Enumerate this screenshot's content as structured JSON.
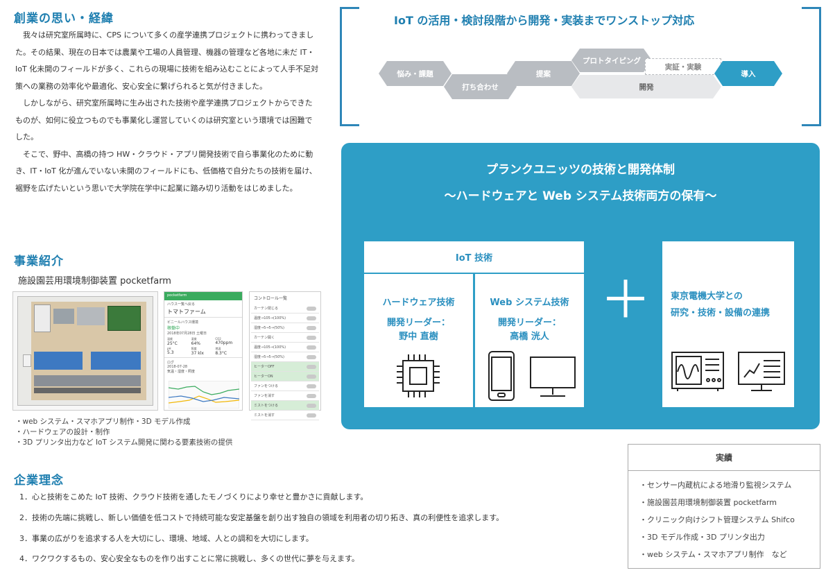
{
  "founding": {
    "heading": "創業の思い・経緯",
    "paragraphs": [
      "我々は研究室所属時に、CPS について多くの産学連携プロジェクトに携わってきました。その結果、現在の日本では農業や工場の人員管理、機器の管理など各地に未だ IT・IoT 化未開のフィールドが多く、これらの現場に技術を組み込むことによって人手不足対策への業務の効率化や最適化、安心安全に繋げられると気が付きました。",
      "しかしながら、研究室所属時に生み出された技術や産学連携プロジェクトからできたものが、如何に役立つものでも事業化し運営していくのは研究室という環境では困難でした。",
      "そこで、野中、高橋の持つ HW・クラウド・アプリ開発技術で自ら事業化のために動き、IT・IoT 化が進んでいない未開のフィールドにも、低価格で自分たちの技術を届け、裾野を広げたいという思いで大学院在学中に起業に踏み切り活動をはじめました。"
    ]
  },
  "business": {
    "heading": "事業紹介",
    "subheading": "施設園芸用環境制御装置 pocketfarm",
    "bullets": [
      "・web システム・スマホアプリ制作・3D モデル作成",
      "・ハードウェアの設計・制作",
      "・3D プリンタ出力など IoT システム開発に関わる要素技術の提供"
    ],
    "app1": {
      "header": "pocketfarm",
      "house_label": "ハウス一覧へ戻る",
      "house_name": "トマトファーム",
      "sensor_label": "ビニールハウス環境",
      "status": "稼働中",
      "date": "2018年07月28日 土曜日",
      "metrics": [
        {
          "label": "温度",
          "value": "25°C"
        },
        {
          "label": "湿度",
          "value": "64%"
        },
        {
          "label": "CO2",
          "value": "470ppm"
        },
        {
          "label": "pH",
          "value": "5.3"
        },
        {
          "label": "照度",
          "value": "37 klx"
        },
        {
          "label": "地温",
          "value": "8.3°C"
        }
      ],
      "log_label": "ログ",
      "log_date": "2018-07-28",
      "chart_label": "気温・湿度・照度"
    },
    "app2": {
      "header": "コントロール一覧",
      "rows": [
        {
          "label": "カーテン閉じる",
          "on": false
        },
        {
          "label": "温度→105→(100%)",
          "on": false
        },
        {
          "label": "湿度→5→5→(50%)",
          "on": false
        },
        {
          "label": "カーテン開く",
          "on": false
        },
        {
          "label": "温度→105→(100%)",
          "on": false
        },
        {
          "label": "湿度→5→5→(50%)",
          "on": false
        },
        {
          "label": "ヒーターOFF",
          "on": true
        },
        {
          "label": "ヒーターON",
          "on": true
        },
        {
          "label": "ファンをつける",
          "on": false
        },
        {
          "label": "ファンを消す",
          "on": false
        },
        {
          "label": "ミストをつける",
          "on": true
        },
        {
          "label": "ミストを消す",
          "on": false
        }
      ]
    }
  },
  "philosophy": {
    "heading": "企業理念",
    "items": [
      "1．心と技術をこめた IoT 技術、クラウド技術を通したモノづくりにより幸せと豊かさに貢献します。",
      "2．技術の先端に挑戦し、新しい価値を低コストで持続可能な安定基盤を創り出す独自の領域を利用者の切り拓き、真の利便性を追求します。",
      "3．事業の広がりを追求する人を大切にし、環境、地域、人との調和を大切にします。",
      "4．ワクワクするもの、安心安全なものを作り出すことに常に挑戦し、多くの世代に夢を与えます。"
    ]
  },
  "flow": {
    "title": "IoT の活用・検討段階から開発・実装までワンストップ対応",
    "steps": {
      "s1": "悩み・課題",
      "s2": "打ち合わせ",
      "s3": "提案",
      "s4": "プロトタイピング",
      "s5": "実証・実験",
      "s6": "開発",
      "s7": "導入"
    }
  },
  "tech": {
    "title_line1": "プランクユニッツの技術と開発体制",
    "title_line2": "～ハードウェアと Web システム技術両方の保有～",
    "iot_label": "IoT 技術",
    "hardware": {
      "title": "ハードウェア技術",
      "lead_label": "開発リーダー：",
      "lead_name": "野中 直樹"
    },
    "web": {
      "title": "Web システム技術",
      "lead_label": "開発リーダー：",
      "lead_name": "高橋 洸人"
    },
    "plus": "＋",
    "university": {
      "line1": "東京電機大学との",
      "line2": "研究・技術・設備の連携"
    }
  },
  "results": {
    "title": "実績",
    "items": [
      "・センサー内蔵杭による地滑り監視システム",
      "・施設園芸用環境制御装置 pocketfarm",
      "・クリニック向けシフト管理システム Shifco",
      "・3D モデル作成・3D プリンタ出力",
      "・web システム・スマホアプリ制作　など"
    ]
  },
  "colors": {
    "accent": "#1f7fb0",
    "panel": "#2e9ec6",
    "chevron_grey": "#b9bdc2",
    "chevron_light": "#e7e8ea"
  }
}
